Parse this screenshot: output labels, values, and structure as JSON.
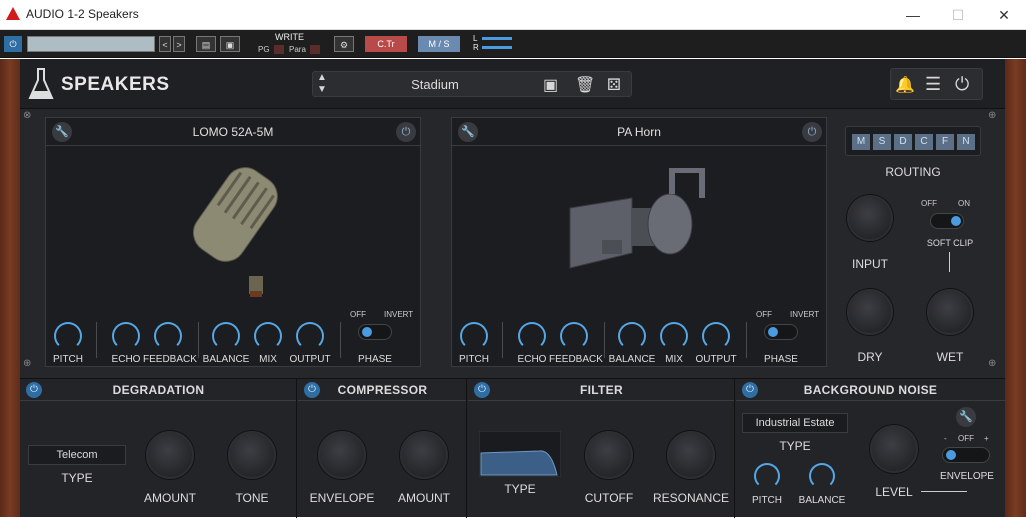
{
  "window": {
    "title": "AUDIO 1-2 Speakers",
    "minimize": "—",
    "maximize": "☐",
    "close": "✕"
  },
  "host": {
    "write": "WRITE",
    "pg": "PG",
    "para": "Para",
    "ctr": "C.Tr",
    "ms": "M / S",
    "l": "L",
    "r": "R"
  },
  "plugin": {
    "brand": "SPEAKERS",
    "preset": "Stadium",
    "left_panel": {
      "title": "LOMO 52A-5M",
      "knobs": [
        "PITCH",
        "ECHO",
        "FEEDBACK",
        "BALANCE",
        "MIX",
        "OUTPUT"
      ],
      "phase": {
        "off": "OFF",
        "invert": "INVERT",
        "label": "PHASE"
      }
    },
    "right_panel": {
      "title": "PA Horn",
      "knobs": [
        "PITCH",
        "ECHO",
        "FEEDBACK",
        "BALANCE",
        "MIX",
        "OUTPUT"
      ],
      "phase": {
        "off": "OFF",
        "invert": "INVERT",
        "label": "PHASE"
      }
    },
    "routing": {
      "buttons": [
        "M",
        "S",
        "D",
        "C",
        "F",
        "N"
      ],
      "label": "ROUTING",
      "input": "INPUT",
      "soft_clip": {
        "off": "OFF",
        "on": "ON",
        "label": "SOFT CLIP"
      },
      "dry": "DRY",
      "wet": "WET"
    },
    "degradation": {
      "title": "DEGRADATION",
      "type_value": "Telecom",
      "type": "TYPE",
      "amount": "AMOUNT",
      "tone": "TONE"
    },
    "compressor": {
      "title": "COMPRESSOR",
      "envelope": "ENVELOPE",
      "amount": "AMOUNT"
    },
    "filter": {
      "title": "FILTER",
      "type": "TYPE",
      "cutoff": "CUTOFF",
      "resonance": "RESONANCE"
    },
    "noise": {
      "title": "BACKGROUND NOISE",
      "type_value": "Industrial Estate",
      "type": "TYPE",
      "pitch": "PITCH",
      "balance": "BALANCE",
      "level": "LEVEL",
      "env_minus": "-",
      "env_off": "OFF",
      "env_plus": "+",
      "envelope": "ENVELOPE"
    }
  },
  "colors": {
    "accent": "#55a7e6",
    "panel": "#1c1d20",
    "wood": "#6b3320"
  }
}
